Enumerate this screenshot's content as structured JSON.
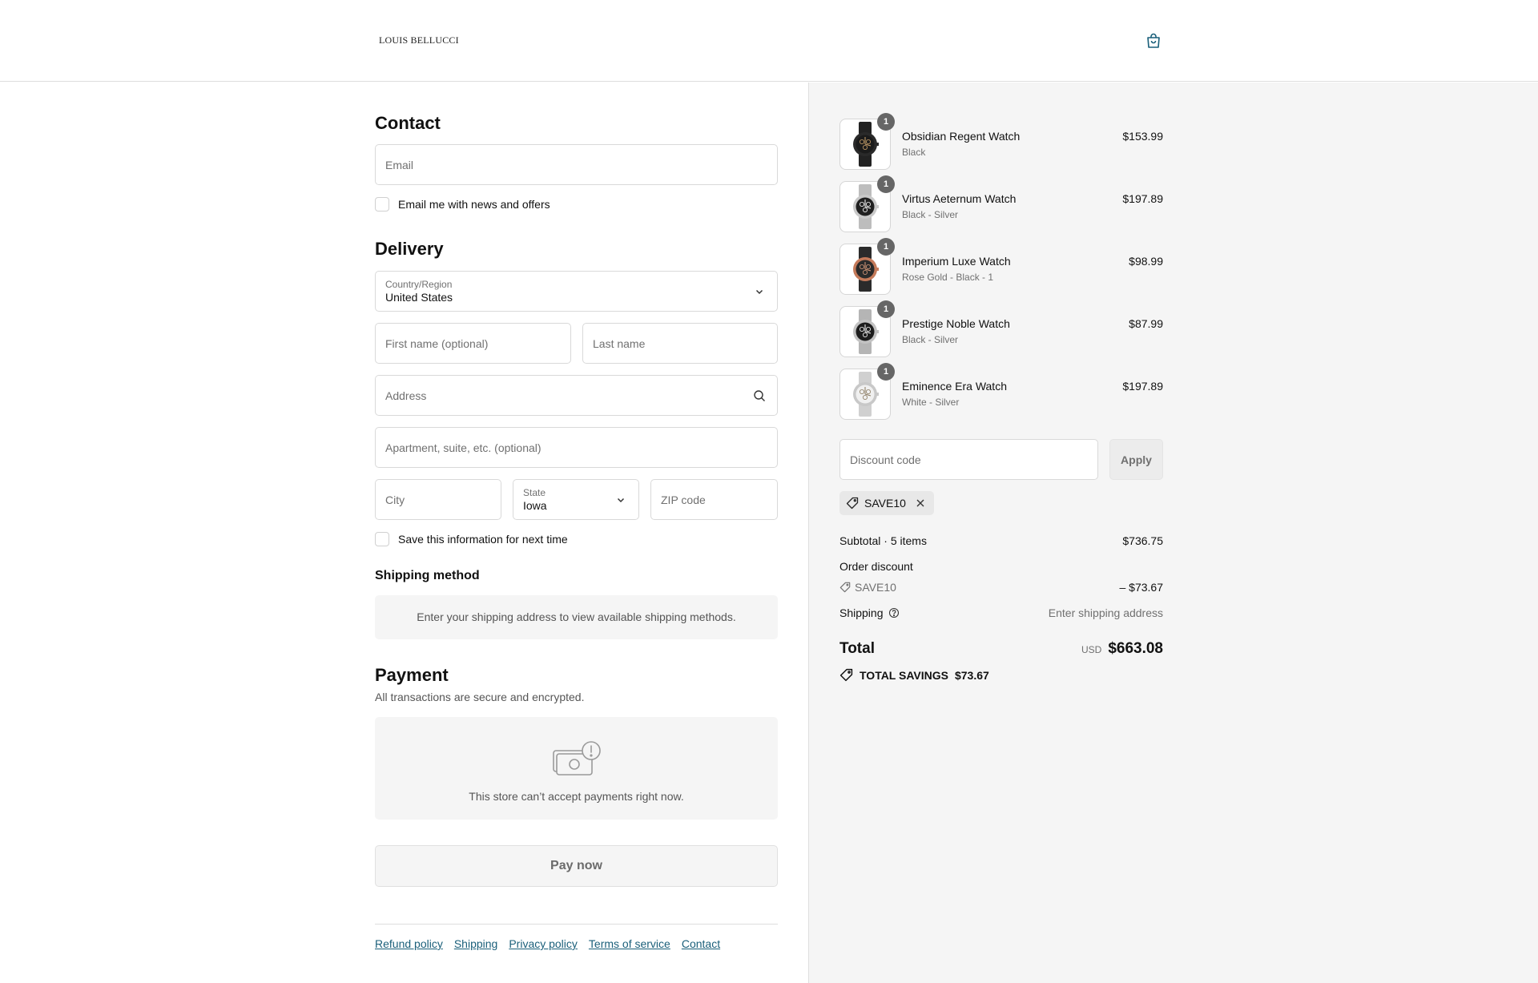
{
  "header": {
    "logo": "LOUIS BELLUCCI"
  },
  "contact": {
    "title": "Contact",
    "email_placeholder": "Email",
    "news_label": "Email me with news and offers"
  },
  "delivery": {
    "title": "Delivery",
    "country_label": "Country/Region",
    "country_value": "United States",
    "first_name_placeholder": "First name (optional)",
    "last_name_placeholder": "Last name",
    "address_placeholder": "Address",
    "apartment_placeholder": "Apartment, suite, etc. (optional)",
    "city_placeholder": "City",
    "state_label": "State",
    "state_value": "Iowa",
    "zip_placeholder": "ZIP code",
    "save_label": "Save this information for next time"
  },
  "shipping": {
    "title": "Shipping method",
    "notice": "Enter your shipping address to view available shipping methods."
  },
  "payment": {
    "title": "Payment",
    "subtitle": "All transactions are secure and encrypted.",
    "notice": "This store can’t accept payments right now.",
    "pay_button": "Pay now"
  },
  "footer": {
    "links": [
      "Refund policy",
      "Shipping",
      "Privacy policy",
      "Terms of service",
      "Contact"
    ]
  },
  "cart": {
    "items": [
      {
        "qty": "1",
        "name": "Obsidian Regent Watch",
        "variant": "Black",
        "price": "$153.99",
        "dial": "#1b1b1b",
        "case": "#2a2a2a",
        "band": "#222222",
        "accent": "#c9a06a"
      },
      {
        "qty": "1",
        "name": "Virtus Aeternum Watch",
        "variant": "Black - Silver",
        "price": "$197.89",
        "dial": "#202020",
        "case": "#c9c9c9",
        "band": "#bdbdbd",
        "accent": "#ffffff"
      },
      {
        "qty": "1",
        "name": "Imperium Luxe Watch",
        "variant": "Rose Gold - Black - 1",
        "price": "$98.99",
        "dial": "#2a2a2a",
        "case": "#c47a5a",
        "band": "#2b2b2b",
        "accent": "#d89a7a"
      },
      {
        "qty": "1",
        "name": "Prestige Noble Watch",
        "variant": "Black - Silver",
        "price": "$87.99",
        "dial": "#1d1d1d",
        "case": "#c2c2c2",
        "band": "#b5b5b5",
        "accent": "#ffffff"
      },
      {
        "qty": "1",
        "name": "Eminence Era Watch",
        "variant": "White - Silver",
        "price": "$197.89",
        "dial": "#f0f0f0",
        "case": "#c8c8c8",
        "band": "#d0d0d0",
        "accent": "#8a7a60"
      }
    ],
    "discount_placeholder": "Discount code",
    "apply_label": "Apply",
    "applied_code": "SAVE10",
    "subtotal_label": "Subtotal · 5 items",
    "subtotal_value": "$736.75",
    "order_discount_label": "Order discount",
    "discount_code_label": "SAVE10",
    "discount_value": "– $73.67",
    "shipping_label": "Shipping",
    "shipping_value": "Enter shipping address",
    "total_label": "Total",
    "currency": "USD",
    "total_value": "$663.08",
    "savings_label": "TOTAL SAVINGS",
    "savings_value": "$73.67"
  },
  "colors": {
    "link": "#1a5f7a",
    "panel_bg": "#f5f5f5",
    "border": "#d9d9d9"
  }
}
